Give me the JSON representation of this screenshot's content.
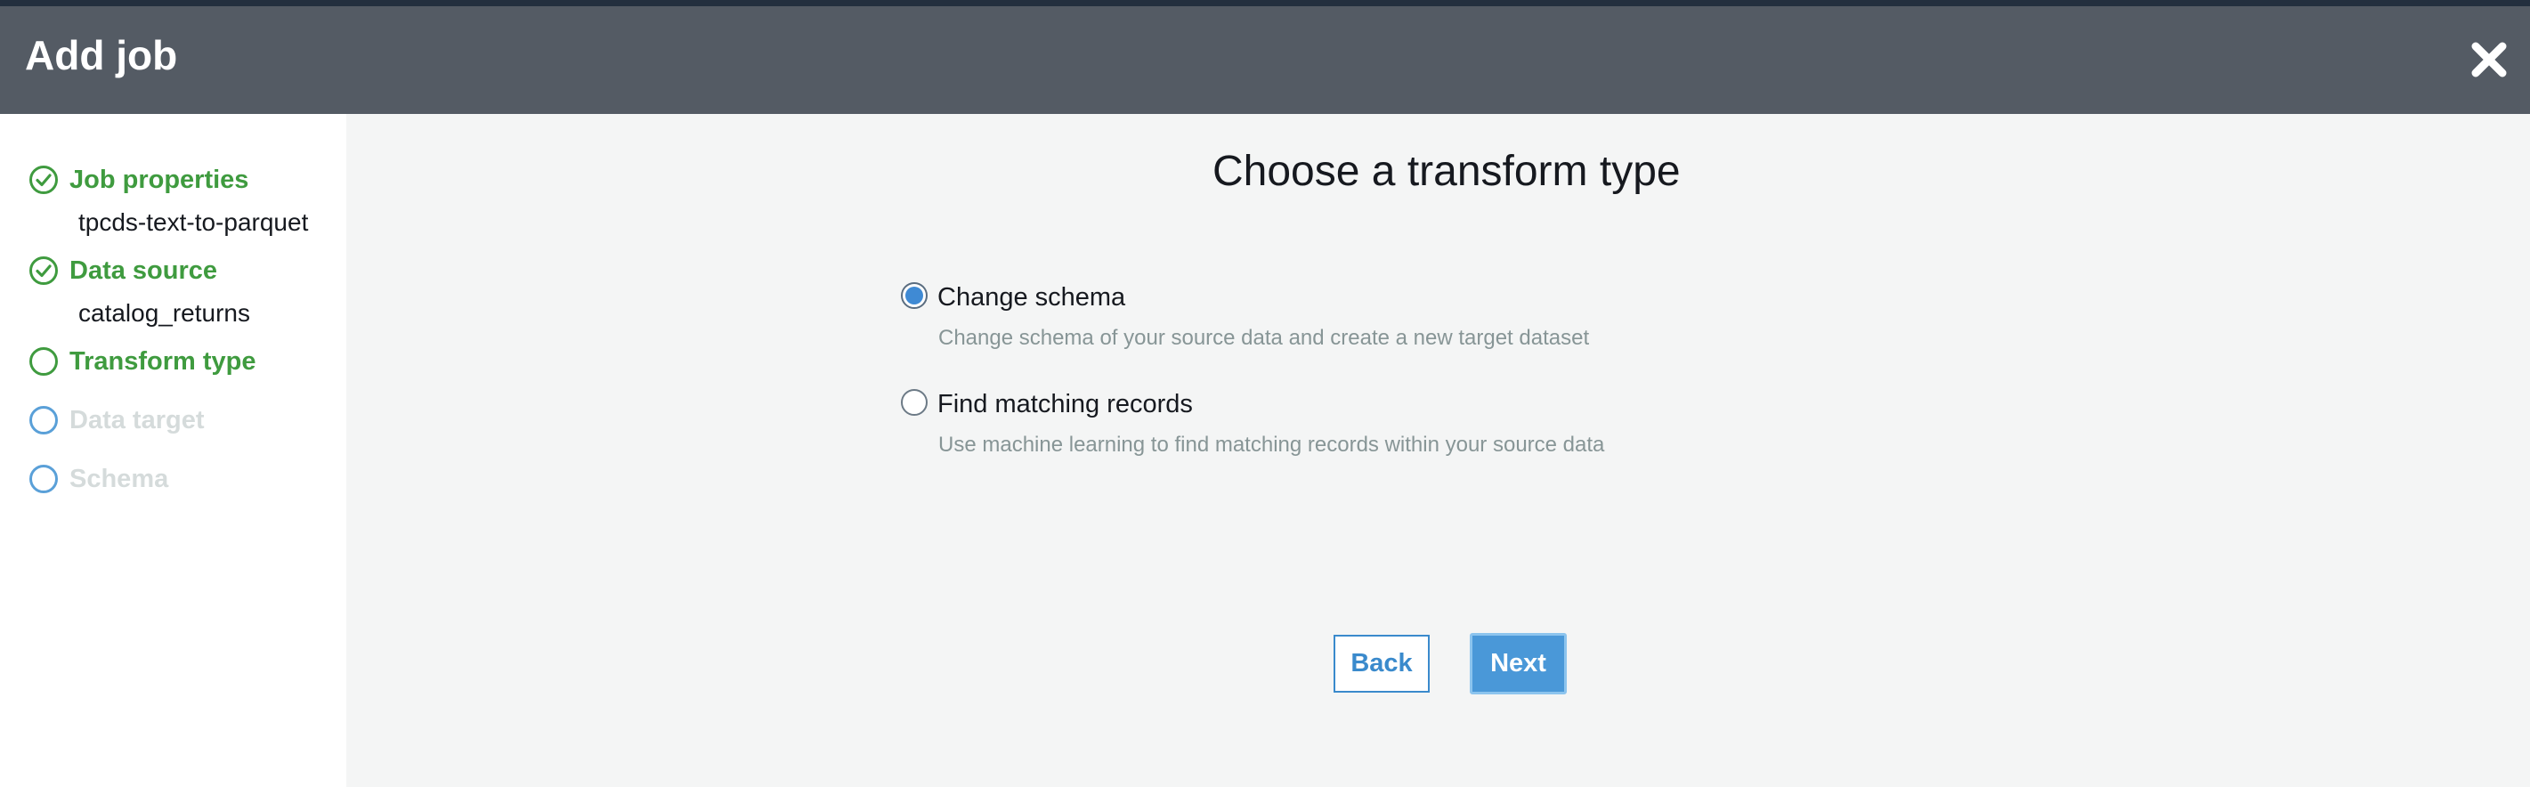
{
  "header": {
    "title": "Add job",
    "close_icon": "close-icon"
  },
  "steps": [
    {
      "label": "Job properties",
      "status": "done",
      "detail": "tpcds-text-to-parquet"
    },
    {
      "label": "Data source",
      "status": "done",
      "detail": "catalog_returns"
    },
    {
      "label": "Transform type",
      "status": "current",
      "detail": ""
    },
    {
      "label": "Data target",
      "status": "pending",
      "detail": ""
    },
    {
      "label": "Schema",
      "status": "pending",
      "detail": ""
    }
  ],
  "main": {
    "title": "Choose a transform type",
    "options": [
      {
        "label": "Change schema",
        "description": "Change schema of your source data and create a new target dataset",
        "selected": true
      },
      {
        "label": "Find matching records",
        "description": "Use machine learning to find matching records within your source data",
        "selected": false
      }
    ],
    "back_label": "Back",
    "next_label": "Next"
  },
  "colors": {
    "header_bg": "#545b64",
    "done_green": "#3f9b3f",
    "pending_blue": "#5aa0d8",
    "pending_text": "#d5dbdb",
    "primary_button": "#4a98d8"
  }
}
